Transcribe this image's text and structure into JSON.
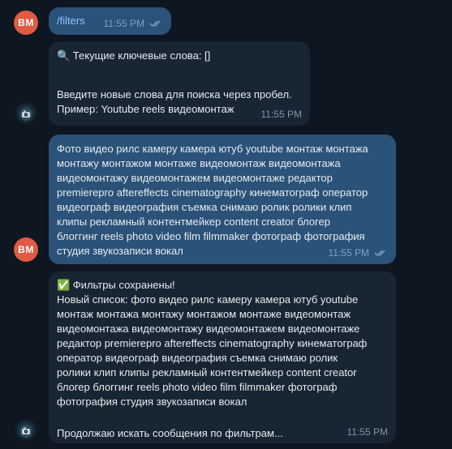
{
  "colors": {
    "background": "#0e1621",
    "outgoing": "#2b5278",
    "incoming": "#182533",
    "user_avatar": "#e05a44"
  },
  "messages": [
    {
      "id": "m1",
      "sender": "user",
      "avatar": "BM",
      "lines": [
        "/filters"
      ],
      "time": "11:55 PM",
      "read": true
    },
    {
      "id": "m2",
      "sender": "bot",
      "lines": [
        "🔍 Текущие ключевые слова: []",
        "",
        "Введите новые слова для поиска через пробел.",
        "Пример: Youtube reels видеомонтаж"
      ],
      "time": "11:55 PM"
    },
    {
      "id": "m3",
      "sender": "user",
      "avatar": "BM",
      "lines": [
        "Фото видео рилс камеру камера ютуб youtube монтаж монтажа",
        "монтажу монтажом монтаже видеомонтаж видеомонтажа",
        "видеомонтажу видеомонтажем видеомонтаже редактор",
        "premierepro aftereffects cinematography кинематограф оператор",
        "видеограф видеография съемка снимаю ролик ролики клип",
        "клипы рекламный контентмейкер content creator блогер",
        "блоггинг reels photo video film filmmaker фотограф фотография",
        "студия звукозаписи вокал"
      ],
      "time": "11:55 PM",
      "read": true
    },
    {
      "id": "m4",
      "sender": "bot",
      "lines": [
        "✅ Фильтры сохранены!",
        "Новый список: фото видео рилс камеру камера ютуб youtube",
        "монтаж монтажа монтажу монтажом монтаже видеомонтаж",
        "видеомонтажа видеомонтажу видеомонтажем видеомонтаже",
        "редактор premierepro aftereffects cinematography кинематограф",
        "оператор видеограф видеография съемка снимаю ролик",
        "ролики клип клипы рекламный контентмейкер content creator",
        "блогер блоггинг reels photo video film filmmaker фотограф",
        "фотография студия звукозаписи вокал",
        "",
        "Продолжаю искать сообщения по фильтрам..."
      ],
      "time": "11:55 PM"
    }
  ]
}
